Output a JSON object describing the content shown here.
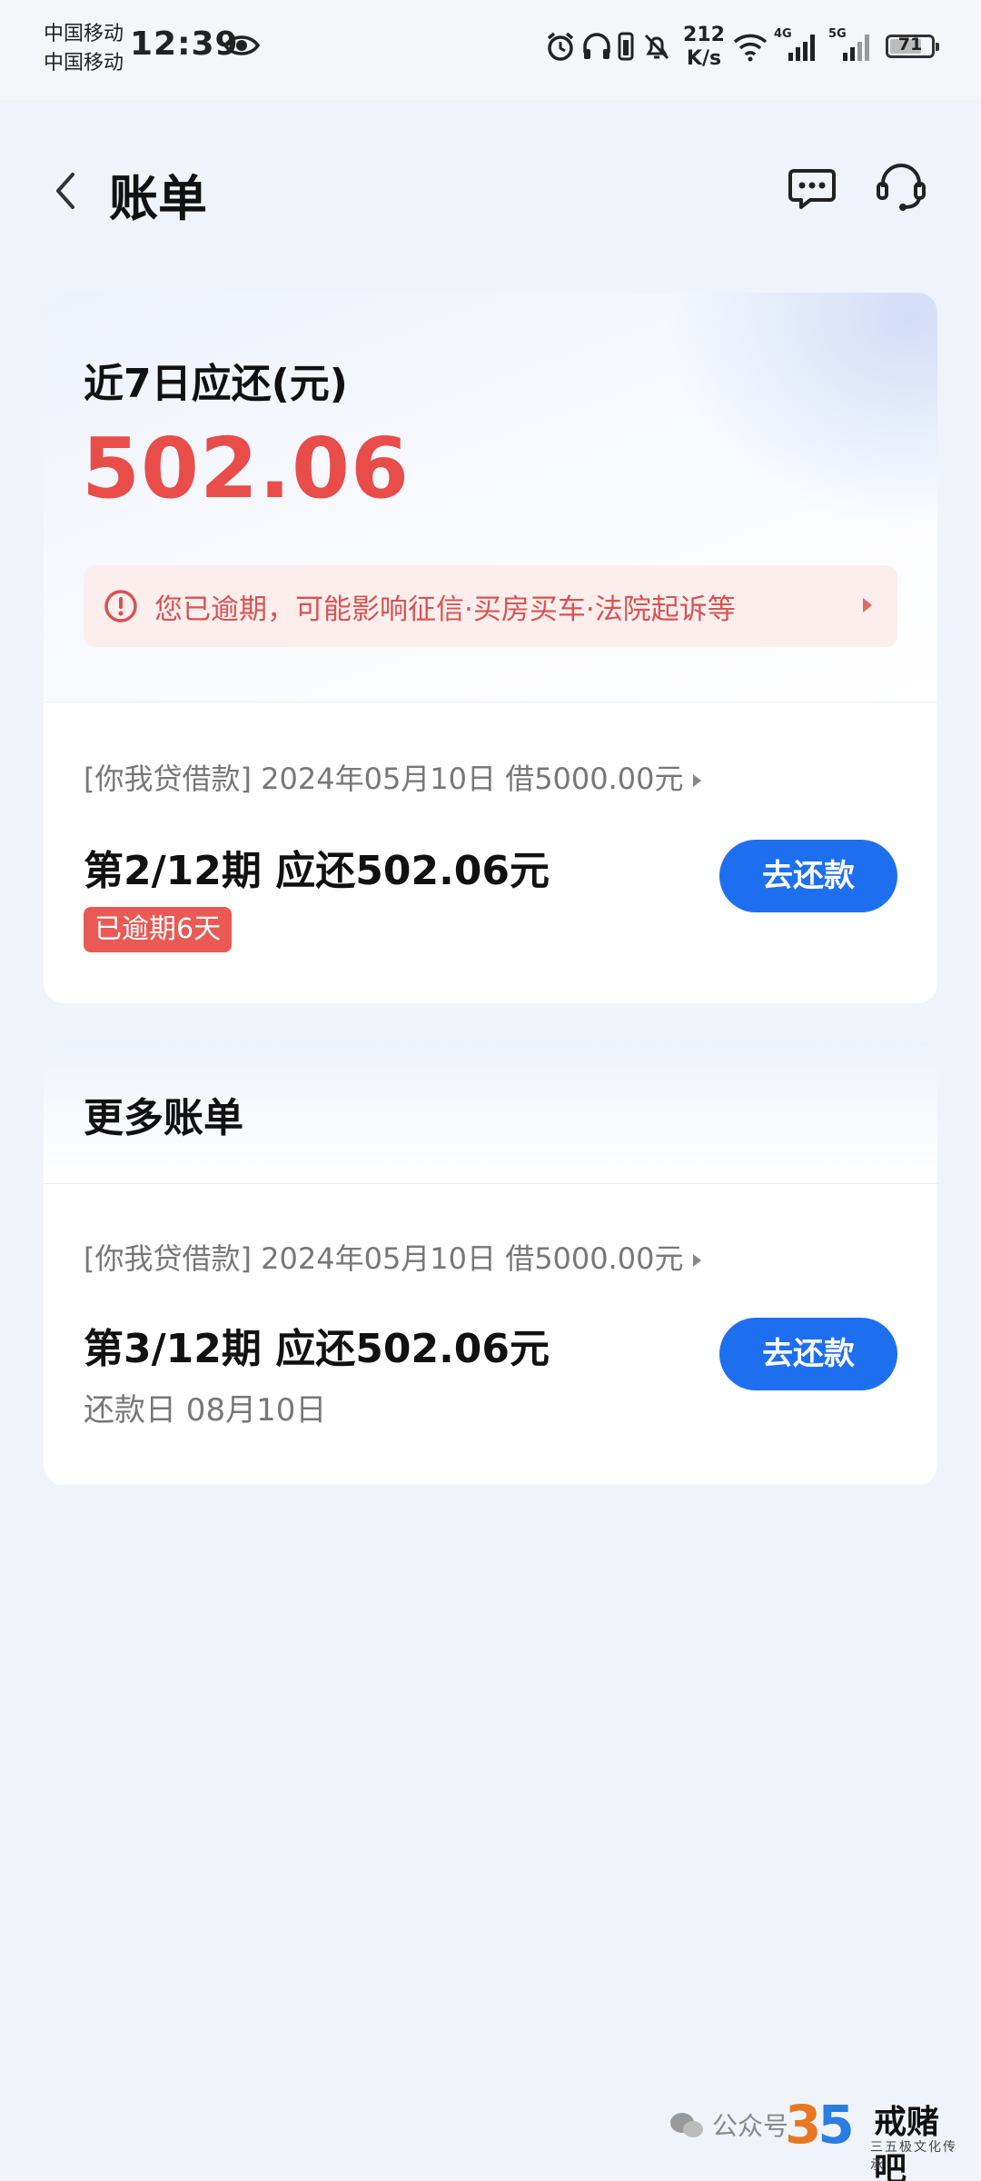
{
  "status_bar": {
    "carrier1": "中国移动",
    "carrier2": "中国移动",
    "time": "12:39",
    "net_speed_value": "212",
    "net_speed_unit": "K/s",
    "signal1": "4G",
    "signal2": "5G",
    "battery": "71"
  },
  "header": {
    "title": "账单"
  },
  "summary": {
    "label": "近7日应还(元)",
    "amount": "502.06",
    "warning": "您已逾期，可能影响征信·买房买车·法院起诉等",
    "bill": {
      "loan_info": "[你我贷借款] 2024年05月10日 借5000.00元",
      "period": "第2/12期 应还502.06元",
      "badge": "已逾期6天",
      "pay_label": "去还款"
    }
  },
  "more": {
    "title": "更多账单",
    "bill": {
      "loan_info": "[你我贷借款] 2024年05月10日 借5000.00元",
      "period": "第3/12期 应还502.06元",
      "due_date": "还款日 08月10日",
      "pay_label": "去还款"
    }
  },
  "watermark": {
    "prefix": "公众号",
    "number_a": "3",
    "number_b": "5",
    "brand": "戒赌吧",
    "sub": "三五极文化传承"
  },
  "colors": {
    "accent_blue": "#1e6ff0",
    "alert_red": "#e84d4a",
    "alert_bg": "#fdeeee"
  }
}
